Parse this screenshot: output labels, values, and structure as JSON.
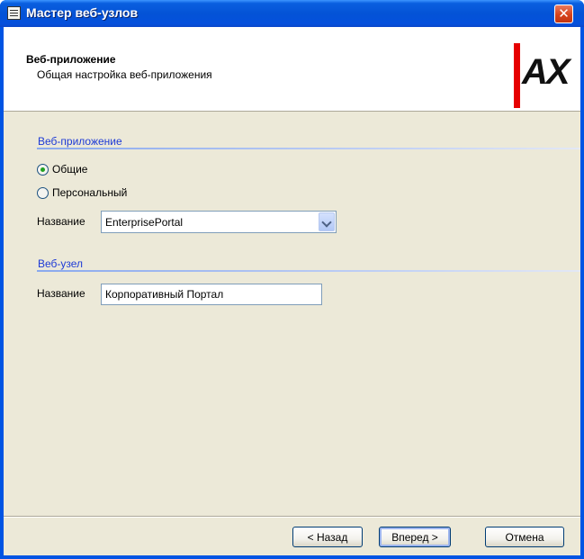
{
  "window": {
    "title": "Мастер веб-узлов",
    "close_glyph": "✕"
  },
  "header": {
    "title": "Веб-приложение",
    "subtitle": "Общая настройка веб-приложения",
    "logo_text": "AX",
    "logo_accent_color": "#e60000"
  },
  "web_app_group": {
    "label": "Веб-приложение",
    "options": [
      {
        "label": "Общие",
        "selected": true
      },
      {
        "label": "Персональный",
        "selected": false
      }
    ],
    "name_label": "Название",
    "name_value": "EnterprisePortal"
  },
  "site_group": {
    "label": "Веб-узел",
    "name_label": "Название",
    "name_value": "Корпоративный Портал"
  },
  "buttons": {
    "back": "< Назад",
    "next": "Вперед >",
    "cancel": "Отмена"
  },
  "colors": {
    "titlebar": "#0054e3",
    "group_label": "#1d3ad6",
    "dialog_face": "#ece9d8"
  }
}
